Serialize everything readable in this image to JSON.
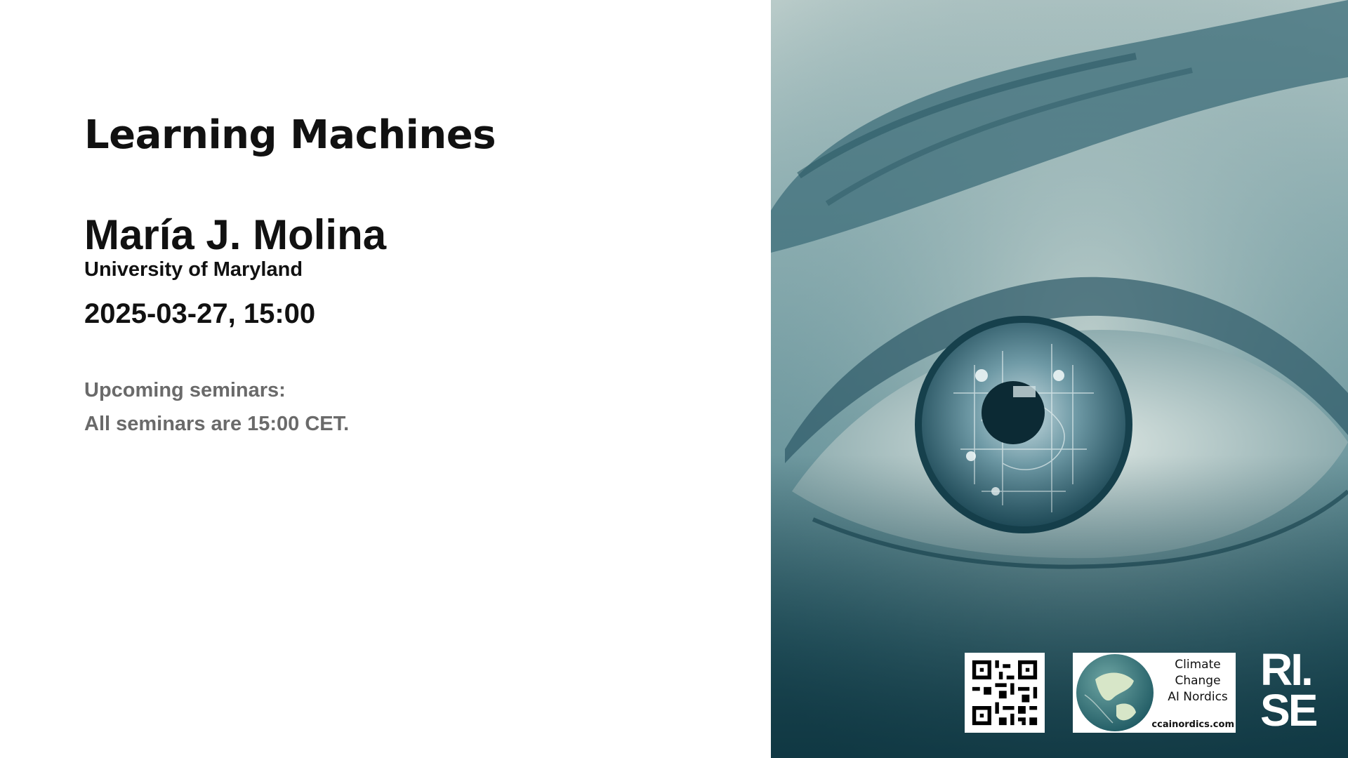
{
  "slide": {
    "series_title": "Learning Machines",
    "speaker_name": "María J. Molina",
    "speaker_affiliation": "University of Maryland",
    "datetime": "2025-03-27, 15:00",
    "upcoming_heading": "Upcoming seminars:",
    "upcoming_note": "All seminars are 15:00 CET."
  },
  "logos": {
    "ccai_line1": "Climate",
    "ccai_line2": "Change",
    "ccai_line3": "AI Nordics",
    "ccai_url": "ccainordics.com",
    "rise_line1": "RI.",
    "rise_line2": "SE"
  },
  "icons": {
    "hero": "eye-photo",
    "qr": "qr-code-icon",
    "globe": "globe-icon"
  },
  "colors": {
    "text": "#111111",
    "muted_text": "#6a6a6a",
    "teal_dark": "#163f4a",
    "teal_light": "#b9cbc9"
  }
}
